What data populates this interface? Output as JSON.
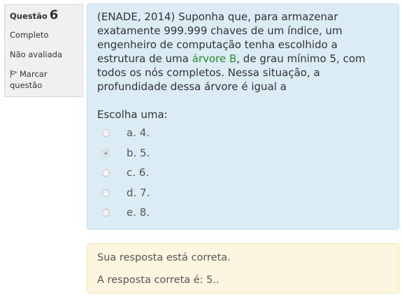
{
  "info": {
    "question_label": "Questão",
    "question_number": "6",
    "status": "Completo",
    "grade": "Não avaliada",
    "flag_label_1": "Marcar",
    "flag_label_2": "questão"
  },
  "question": {
    "text_before": "(ENADE, 2014)  Suponha que, para armazenar exatamente 999.999 chaves de um índice, um engenheiro de computação tenha escolhido a estrutura de uma ",
    "link_text": "árvore B",
    "text_after": ", de grau mínimo 5, com todos os nós completos. Nessa situação, a profundidade dessa árvore é igual a",
    "prompt": "Escolha uma:",
    "options": [
      {
        "label": "a. 4.",
        "selected": false
      },
      {
        "label": "b. 5.",
        "selected": true
      },
      {
        "label": "c. 6.",
        "selected": false
      },
      {
        "label": "d. 7.",
        "selected": false
      },
      {
        "label": "e. 8.",
        "selected": false
      }
    ]
  },
  "feedback": {
    "line1": "Sua resposta está correta.",
    "line2": "A resposta correta é: 5.."
  },
  "colors": {
    "content_bg": "#dbecf5",
    "feedback_bg": "#fcf6e1",
    "link": "#2a8a2a"
  }
}
